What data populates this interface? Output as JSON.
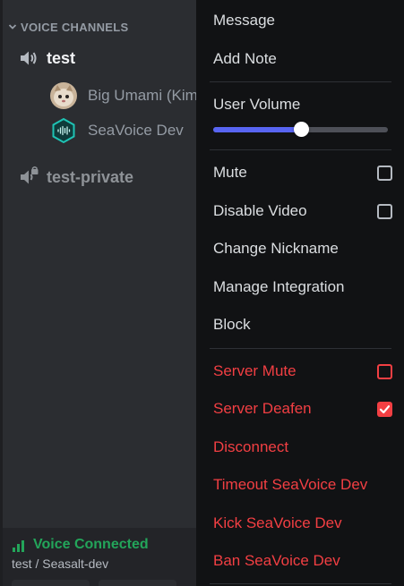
{
  "sidebar": {
    "category": "VOICE CHANNELS",
    "channels": [
      {
        "name": "test",
        "icon": "speaker-icon"
      },
      {
        "name": "test-private",
        "icon": "locked-speaker-icon"
      }
    ],
    "voice_users": [
      {
        "name": "Big Umami (Kim",
        "avatar": "cat-photo-avatar"
      },
      {
        "name": "SeaVoice Dev",
        "avatar": "hexagon-waveform-avatar"
      }
    ],
    "voice_panel": {
      "status": "Voice Connected",
      "location": "test / Seasalt-dev"
    }
  },
  "menu": {
    "message": "Message",
    "add_note": "Add Note",
    "user_volume": {
      "label": "User Volume",
      "level": 0.5
    },
    "mute": {
      "label": "Mute",
      "checked": false
    },
    "disable_video": {
      "label": "Disable Video",
      "checked": false
    },
    "change_nickname": "Change Nickname",
    "manage_integration": "Manage Integration",
    "block": "Block",
    "server_mute": {
      "label": "Server Mute",
      "checked": false
    },
    "server_deafen": {
      "label": "Server Deafen",
      "checked": true
    },
    "disconnect": "Disconnect",
    "timeout": "Timeout SeaVoice Dev",
    "kick": "Kick SeaVoice Dev",
    "ban": "Ban SeaVoice Dev"
  },
  "colors": {
    "danger": "#f23f43",
    "accent": "#5865f2",
    "connected": "#23a55a",
    "menu_bg": "#111214",
    "sidebar_bg": "#2b2d31"
  }
}
